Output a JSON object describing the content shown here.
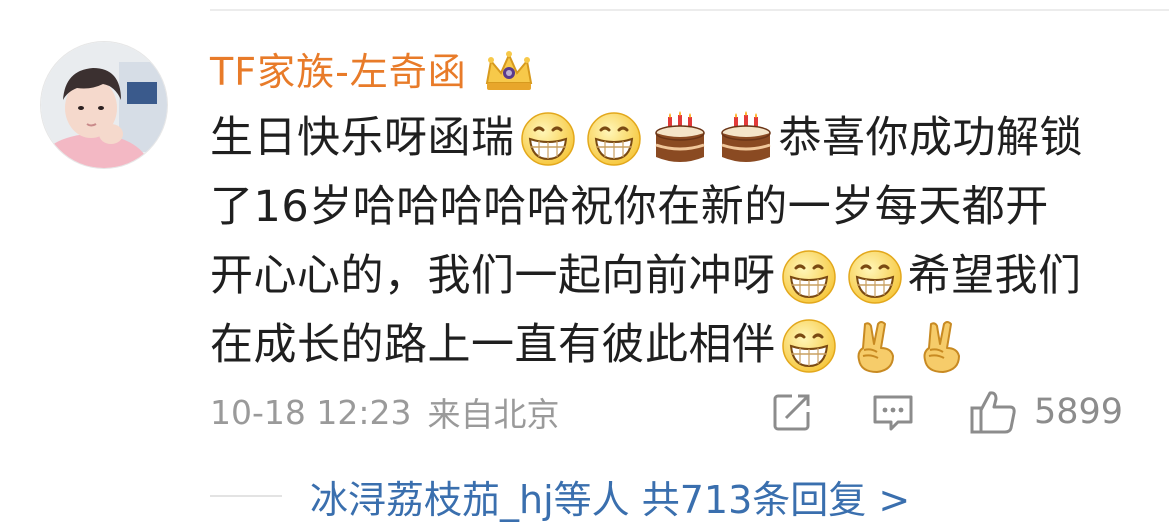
{
  "comment": {
    "username": "TF家族-左奇函",
    "badge_icon": "crown-icon",
    "lines": [
      [
        "生日快乐呀函瑞",
        "emoji:grin",
        "emoji:grin",
        "emoji:cake",
        "emoji:cake",
        "恭喜你成功解锁"
      ],
      [
        "了16岁哈哈哈哈哈祝你在新的一岁每天都开"
      ],
      [
        "开心心的，我们一起向前冲呀",
        "emoji:grin",
        "emoji:grin",
        "希望我们"
      ],
      [
        "在成长的路上一直有彼此相伴",
        "emoji:grin",
        "emoji:victory",
        "emoji:victory"
      ]
    ],
    "timestamp": "10-18 12:23",
    "location": "来自北京",
    "like_count": "5899",
    "actions": {
      "share_icon": "share-icon",
      "reply_icon": "comment-icon",
      "like_icon": "thumbs-up-icon"
    }
  },
  "replies": {
    "summary": "冰浔荔枝茄_hj等人 共713条回复 >"
  },
  "colors": {
    "username": "#e87b29",
    "link": "#3a6fae",
    "meta": "#9a9a9a"
  }
}
